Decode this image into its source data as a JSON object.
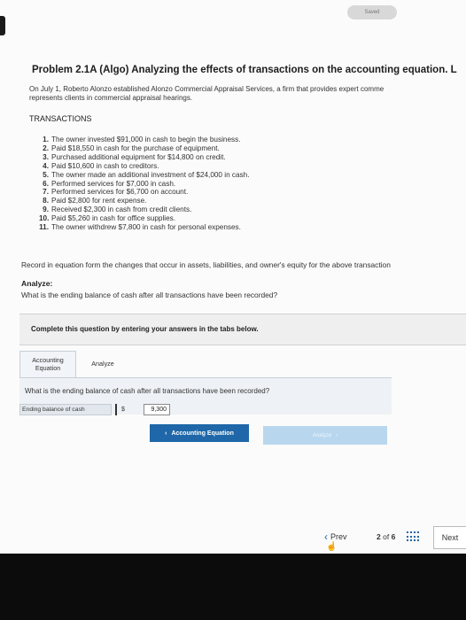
{
  "header": {
    "saved_label": "Saved"
  },
  "problem": {
    "title": "Problem 2.1A (Algo) Analyzing the effects of transactions on the accounting equation. L",
    "intro_line1": "On July 1, Roberto Alonzo established Alonzo Commercial Appraisal Services, a firm that provides expert comme",
    "intro_line2": "represents clients in commercial appraisal hearings."
  },
  "transactions": {
    "heading": "TRANSACTIONS",
    "items": [
      {
        "num": "1.",
        "text": "The owner invested $91,000 in cash to begin the business."
      },
      {
        "num": "2.",
        "text": "Paid $18,550 in cash for the purchase of equipment."
      },
      {
        "num": "3.",
        "text": "Purchased additional equipment for $14,800 on credit."
      },
      {
        "num": "4.",
        "text": "Paid $10,600 in cash to creditors."
      },
      {
        "num": "5.",
        "text": "The owner made an additional investment of $24,000 in cash."
      },
      {
        "num": "6.",
        "text": "Performed services for $7,000 in cash."
      },
      {
        "num": "7.",
        "text": "Performed services for $6,700 on account."
      },
      {
        "num": "8.",
        "text": "Paid $2,800 for rent expense."
      },
      {
        "num": "9.",
        "text": "Received $2,300 in cash from credit clients."
      },
      {
        "num": "10.",
        "text": "Paid $5,260 in cash for office supplies."
      },
      {
        "num": "11.",
        "text": "The owner withdrew $7,800 in cash for personal expenses."
      }
    ]
  },
  "instructions": {
    "record": "Record in equation form the changes that occur in assets, liabilities, and owner's equity for the above transaction",
    "analyze_title": "Analyze:",
    "analyze_question": "What is the ending balance of cash after all transactions have been recorded?"
  },
  "complete_box": {
    "text": "Complete this question by entering your answers in the tabs below."
  },
  "tabs": [
    {
      "line1": "Accounting",
      "line2": "Equation"
    },
    {
      "line1": "Analyze",
      "line2": ""
    }
  ],
  "panel": {
    "question": "What is the ending balance of cash after all transactions have been recorded?",
    "cash_label": "Ending balance of cash",
    "currency": "$",
    "cash_value": "9,300"
  },
  "buttons": {
    "accounting_equation": "Accounting Equation",
    "analyze": "Analyze"
  },
  "navigation": {
    "prev_label": "Prev",
    "current_page": "2",
    "of_label": "of",
    "total_pages": "6",
    "next_label": "Next"
  },
  "colors": {
    "accent": "#1f67a8",
    "disabled_button": "#b8d7ef"
  }
}
